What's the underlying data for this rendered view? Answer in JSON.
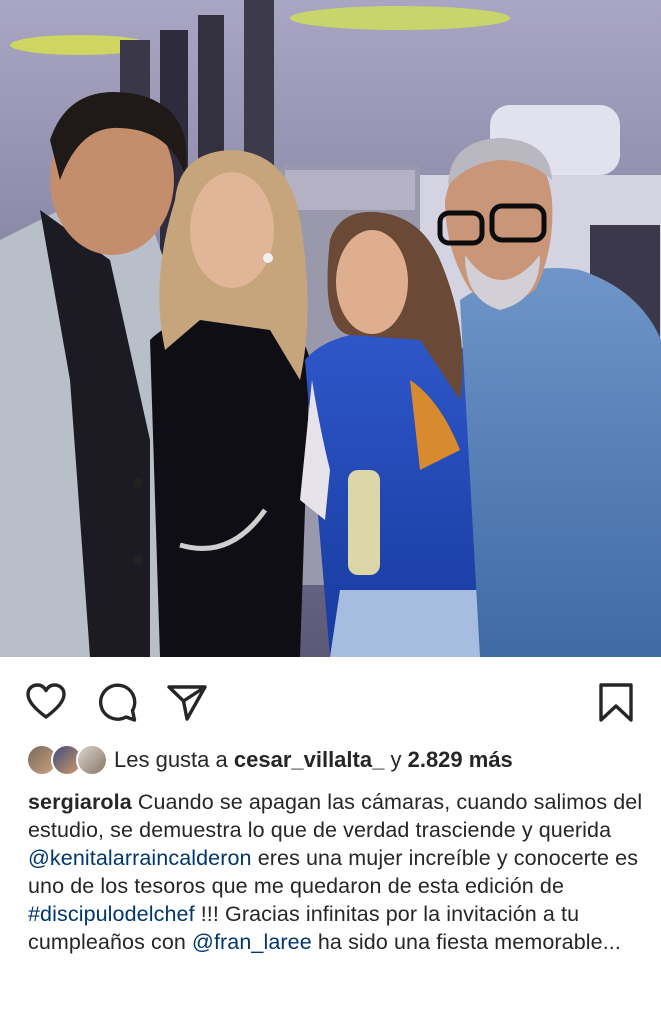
{
  "post": {
    "photo_alt_icon": "group-photo",
    "actions": {
      "like_icon": "heart-icon",
      "comment_icon": "comment-icon",
      "share_icon": "send-icon",
      "save_icon": "bookmark-icon"
    },
    "likes": {
      "prefix": "Les gusta a",
      "user": "cesar_villalta_",
      "joiner": "y",
      "count": "2.829 más"
    },
    "caption": {
      "username": "sergiarola",
      "text_1": "Cuando se apagan las cámaras, cuando salimos del estudio, se demuestra lo que de verdad trasciende  y querida",
      "mention_1": "@kenitalarraincalderon",
      "text_2": "eres una mujer increíble y conocerte es uno de los tesoros que me quedaron de esta edición de",
      "hashtag": "#discipulodelchef",
      "text_3": "!!! Gracias infinitas por la invitación a tu cumpleaños con",
      "mention_2": "@fran_laree",
      "text_4": "ha sido una fiesta memorable..."
    }
  },
  "colors": {
    "text": "#262626",
    "link": "#00376b",
    "background": "#ffffff"
  }
}
